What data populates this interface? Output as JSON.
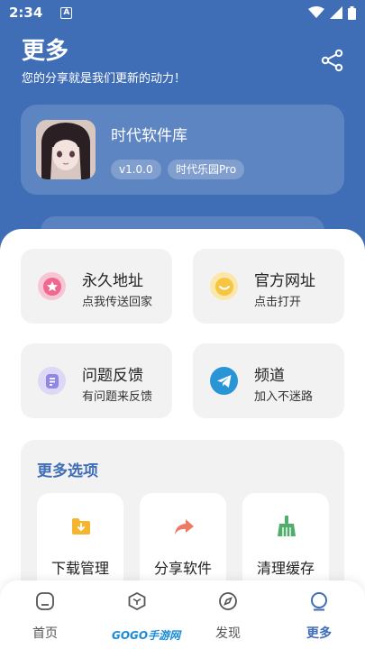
{
  "status_bar": {
    "time": "2:34",
    "notification_glyph": "A"
  },
  "header": {
    "title": "更多",
    "subtitle": "您的分享就是我们更新的动力！"
  },
  "profile": {
    "app_name": "时代软件库",
    "version": "v1.0.0",
    "variant": "时代乐园Pro"
  },
  "tiles": [
    {
      "title": "永久地址",
      "subtitle": "点我传送回家",
      "icon": "star-icon",
      "color": "#f0678f"
    },
    {
      "title": "官方网址",
      "subtitle": "点击打开",
      "icon": "chat-bubble-icon",
      "color": "#f6c542"
    },
    {
      "title": "问题反馈",
      "subtitle": "有问题来反馈",
      "icon": "feedback-icon",
      "color": "#8f86e6"
    },
    {
      "title": "频道",
      "subtitle": "加入不迷路",
      "icon": "telegram-icon",
      "color": "#2a95d6"
    }
  ],
  "more_options": {
    "title": "更多选项",
    "items": [
      {
        "label": "下载管理",
        "icon": "download-folder-icon",
        "color": "#f5b52e"
      },
      {
        "label": "分享软件",
        "icon": "share-arrow-icon",
        "color": "#ef7a63"
      },
      {
        "label": "清理缓存",
        "icon": "broom-icon",
        "color": "#4fae6a"
      }
    ]
  },
  "nav": {
    "items": [
      {
        "label": "首页",
        "icon": "home-icon"
      },
      {
        "label": "",
        "icon": "cube-icon"
      },
      {
        "label": "发现",
        "icon": "compass-icon"
      },
      {
        "label": "更多",
        "icon": "more-circle-icon",
        "active": true
      }
    ],
    "watermark_text": "GOGO手游网"
  },
  "colors": {
    "primary": "#3f6eb6",
    "card_bg": "#f2f2f2"
  }
}
